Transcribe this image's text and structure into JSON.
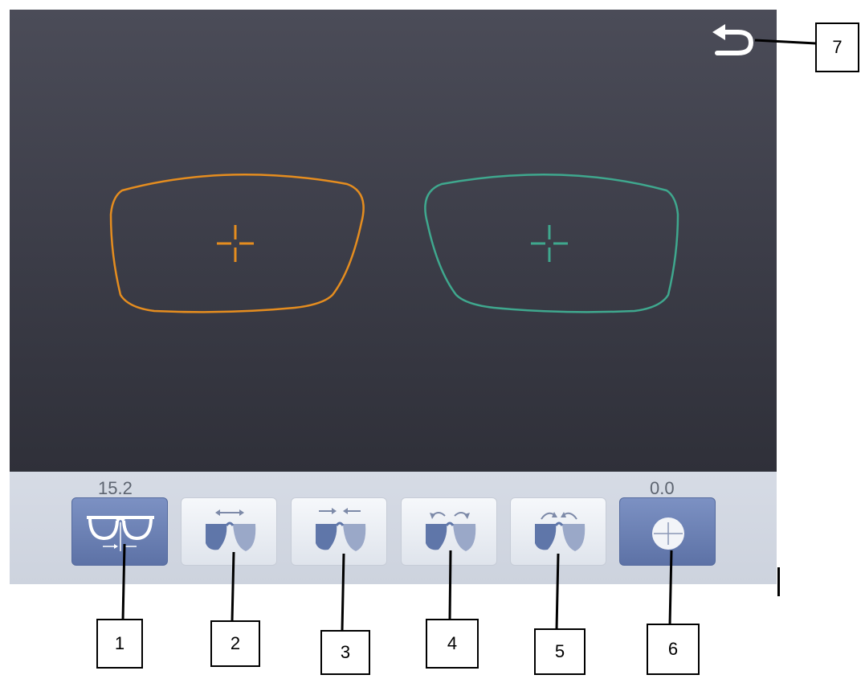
{
  "values": {
    "left": "15.2",
    "right": "0.0"
  },
  "toolbar": {
    "buttons": [
      {
        "id": "1",
        "icon": "glasses-width-icon",
        "active": true
      },
      {
        "id": "2",
        "icon": "expand-horizontal-icon",
        "active": false
      },
      {
        "id": "3",
        "icon": "contract-horizontal-icon",
        "active": false
      },
      {
        "id": "4",
        "icon": "rotate-outward-icon",
        "active": false
      },
      {
        "id": "5",
        "icon": "rotate-inward-icon",
        "active": false
      },
      {
        "id": "6",
        "icon": "centering-icon",
        "active": true
      }
    ]
  },
  "back_icon": "return-arrow-icon",
  "lenses": {
    "left_color": "#e58d1f",
    "right_color": "#3fa88e"
  },
  "callouts": {
    "c1": "1",
    "c2": "2",
    "c3": "3",
    "c4": "4",
    "c5": "5",
    "c6": "6",
    "c7": "7"
  }
}
